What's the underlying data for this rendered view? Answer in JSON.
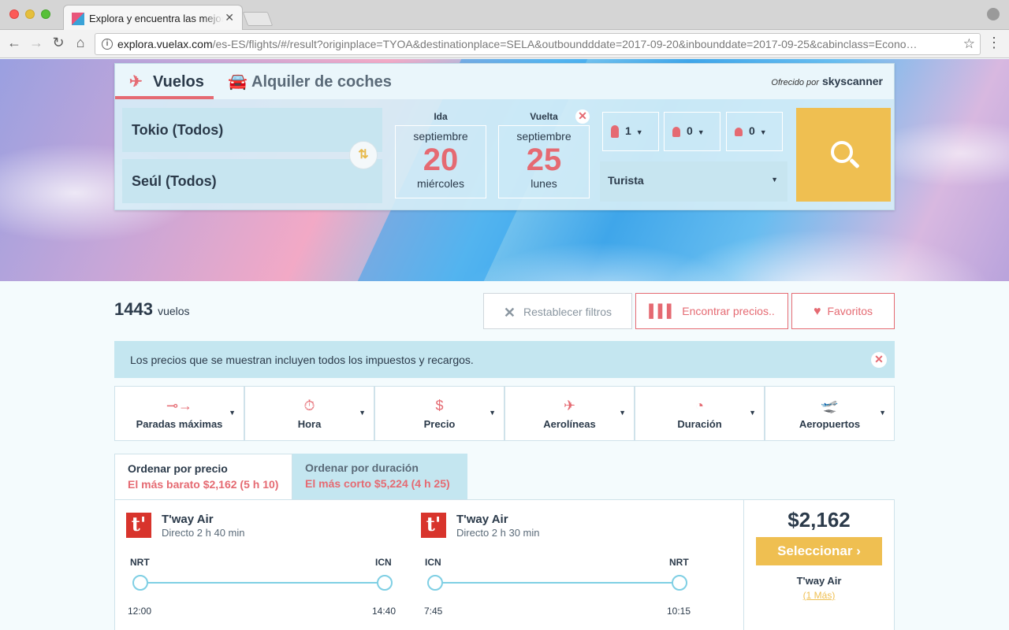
{
  "browser": {
    "tab_title": "Explora y encuentra las mejores",
    "url_host": "explora.vuelax.com",
    "url_path": "/es-ES/flights/#/result?originplace=TYOA&destinationplace=SELA&outboundddate=2017-09-20&inbounddate=2017-09-25&cabinclass=Econo…"
  },
  "search": {
    "modes": [
      {
        "label": "Vuelos",
        "icon": "plane-icon",
        "active": true
      },
      {
        "label": "Alquiler de coches",
        "icon": "car-icon",
        "active": false
      }
    ],
    "powered_by_label": "Ofrecido por",
    "powered_by_brand": "skyscanner",
    "origin": "Tokio (Todos)",
    "destination": "Seúl (Todos)",
    "outbound": {
      "label": "Ida",
      "month": "septiembre",
      "day": "20",
      "weekday": "miércoles"
    },
    "inbound": {
      "label": "Vuelta",
      "month": "septiembre",
      "day": "25",
      "weekday": "lunes"
    },
    "passengers": {
      "adults": "1",
      "children": "0",
      "infants": "0"
    },
    "cabin_class": "Turista"
  },
  "results": {
    "count": "1443",
    "count_label": "vuelos",
    "reset_filters": "Restablecer filtros",
    "find_prices": "Encontrar precios..",
    "favorites": "Favoritos",
    "notice": "Los precios que se muestran incluyen todos los impuestos y recargos.",
    "filters": [
      {
        "label": "Paradas máximas",
        "icon": "stops-icon"
      },
      {
        "label": "Hora",
        "icon": "stopwatch-icon"
      },
      {
        "label": "Precio",
        "icon": "price-icon"
      },
      {
        "label": "Aerolíneas",
        "icon": "plane-icon"
      },
      {
        "label": "Duración",
        "icon": "clock-icon"
      },
      {
        "label": "Aeropuertos",
        "icon": "takeoff-icon"
      }
    ],
    "sort": [
      {
        "title": "Ordenar por precio",
        "subtitle": "El más barato $2,162 (5 h 10)",
        "active": true
      },
      {
        "title": "Ordenar por duración",
        "subtitle": "El más corto $5,224 (4 h 25)",
        "active": false
      }
    ],
    "first_result": {
      "outbound": {
        "airline": "T'way Air",
        "info": "Directo  2 h 40 min",
        "from": "NRT",
        "to": "ICN",
        "depart": "12:00",
        "arrive": "14:40"
      },
      "inbound": {
        "airline": "T'way Air",
        "info": "Directo  2 h 30 min",
        "from": "ICN",
        "to": "NRT",
        "depart": "7:45",
        "arrive": "10:15"
      },
      "airline_logo_letter": "t'",
      "price": "$2,162",
      "select_label": "Seleccionar",
      "price_airline": "T'way Air",
      "more_label": "(1 Más)"
    }
  },
  "colors": {
    "accent": "#e56a72",
    "cta": "#efbf51",
    "panel": "#c4e6f0",
    "text": "#2b3a4a"
  }
}
